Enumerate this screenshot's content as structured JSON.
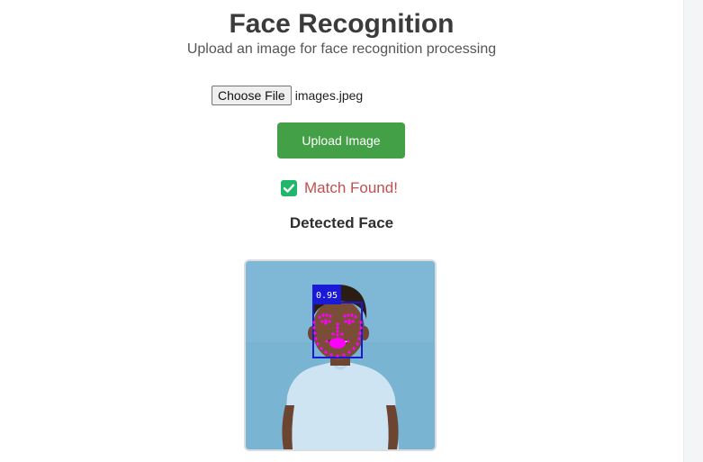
{
  "header": {
    "title": "Face Recognition",
    "subtitle": "Upload an image for face recognition processing"
  },
  "upload_form": {
    "choose_file_label": "Choose File",
    "selected_file": "images.jpeg",
    "upload_button_label": "Upload Image"
  },
  "result": {
    "status_icon": "check-square-icon",
    "status_text": "Match Found!",
    "status_color": "#c0504d",
    "detected_heading": "Detected Face",
    "confidence": "0.95"
  },
  "colors": {
    "upload_button": "#43a047",
    "check_icon": "#21b76b",
    "bounding_box": "#1a1ad6",
    "landmarks": "#ff00ff",
    "image_background": "#7ab4d3"
  }
}
